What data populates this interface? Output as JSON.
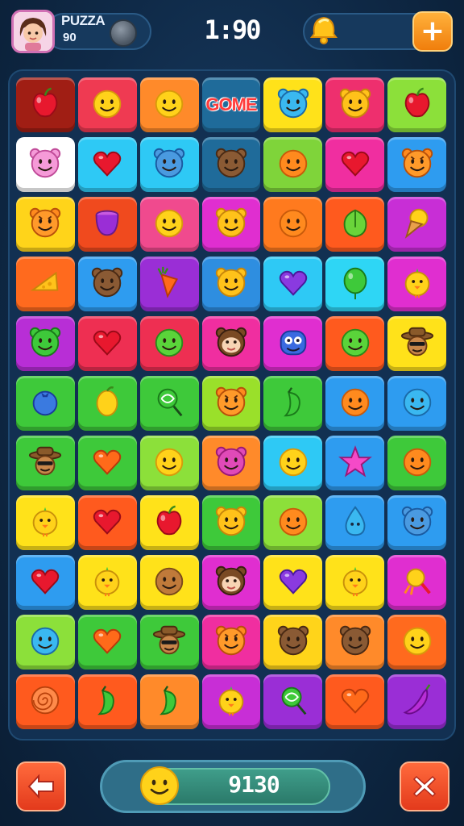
{
  "header": {
    "player_name": "PUZZA",
    "player_score": "90",
    "timer": "1:90",
    "add_button_label": "+"
  },
  "board": {
    "rows": 11,
    "cols": 7,
    "tiles": [
      [
        {
          "color": "#a01e14",
          "icon": "red-apple-icon"
        },
        {
          "color": "#ef3a52",
          "icon": "smiley-face-icon"
        },
        {
          "color": "#ff8a2a",
          "icon": "smiley-face-icon"
        },
        {
          "color": "#1f6b9a",
          "icon": "game-sign",
          "text": "GOME"
        },
        {
          "color": "#ffe21a",
          "icon": "blue-cat-face-icon"
        },
        {
          "color": "#ee2f6e",
          "icon": "yellow-bear-icon"
        },
        {
          "color": "#8ce03a",
          "icon": "red-apple-icon"
        }
      ],
      [
        {
          "color": "#ffffff",
          "icon": "pink-cat-face-icon"
        },
        {
          "color": "#2ec9f5",
          "icon": "red-heart-icon"
        },
        {
          "color": "#2ec9f5",
          "icon": "blue-bear-face-icon"
        },
        {
          "color": "#1f6b9a",
          "icon": "brown-bear-face-icon"
        },
        {
          "color": "#7fd43a",
          "icon": "orange-face-icon"
        },
        {
          "color": "#f02ea0",
          "icon": "red-heart-icon"
        },
        {
          "color": "#2e9cf0",
          "icon": "orange-tiger-face-icon"
        }
      ],
      [
        {
          "color": "#ffd41a",
          "icon": "orange-tiger-face-icon"
        },
        {
          "color": "#f04a1e",
          "icon": "purple-pot-icon"
        },
        {
          "color": "#f04a8e",
          "icon": "smiley-face-icon"
        },
        {
          "color": "#e02ed0",
          "icon": "yellow-bear-icon"
        },
        {
          "color": "#ff7a1e",
          "icon": "orange-face-icon"
        },
        {
          "color": "#ff5a1e",
          "icon": "green-fruit-icon"
        },
        {
          "color": "#c82ed6",
          "icon": "ice-cream-cone-icon"
        }
      ],
      [
        {
          "color": "#ff6a1e",
          "icon": "cheese-icon"
        },
        {
          "color": "#2e9cf0",
          "icon": "brown-bear-face-icon"
        },
        {
          "color": "#9a2ed6",
          "icon": "orange-carrot-icon"
        },
        {
          "color": "#2e8ee0",
          "icon": "yellow-bear-icon"
        },
        {
          "color": "#2ec9f5",
          "icon": "purple-heart-icon"
        },
        {
          "color": "#2ed6f5",
          "icon": "green-balloon-icon"
        },
        {
          "color": "#e02ed0",
          "icon": "yellow-chick-icon"
        }
      ],
      [
        {
          "color": "#b82ed6",
          "icon": "green-bear-face-icon"
        },
        {
          "color": "#ee2f52",
          "icon": "red-heart-icon"
        },
        {
          "color": "#ee2f52",
          "icon": "green-face-icon"
        },
        {
          "color": "#f02ea0",
          "icon": "monkey-face-icon"
        },
        {
          "color": "#e02ed0",
          "icon": "blue-monster-face-icon"
        },
        {
          "color": "#ff5a1e",
          "icon": "green-face-icon"
        },
        {
          "color": "#ffe21a",
          "icon": "cowboy-face-icon"
        }
      ],
      [
        {
          "color": "#3ec93a",
          "icon": "blue-blueberry-icon"
        },
        {
          "color": "#3ec93a",
          "icon": "yellow-lemon-icon"
        },
        {
          "color": "#3ec93a",
          "icon": "green-lollipop-icon"
        },
        {
          "color": "#9ae02a",
          "icon": "orange-tiger-face-icon"
        },
        {
          "color": "#3ec93a",
          "icon": "green-pepper-icon"
        },
        {
          "color": "#2e9cf0",
          "icon": "orange-face-icon"
        },
        {
          "color": "#2e9cf0",
          "icon": "blue-face-icon"
        }
      ],
      [
        {
          "color": "#3ec93a",
          "icon": "cowboy-face-icon"
        },
        {
          "color": "#3ec93a",
          "icon": "orange-heart-icon"
        },
        {
          "color": "#8ce03a",
          "icon": "smiley-face-icon"
        },
        {
          "color": "#ff8a2a",
          "icon": "pink-bear-face-icon"
        },
        {
          "color": "#2ec9f5",
          "icon": "smiley-face-icon"
        },
        {
          "color": "#2e9cf0",
          "icon": "pink-star-icon"
        },
        {
          "color": "#3ec93a",
          "icon": "orange-face-icon"
        }
      ],
      [
        {
          "color": "#ffe21a",
          "icon": "yellow-chick-icon"
        },
        {
          "color": "#ff5a1e",
          "icon": "red-heart-icon"
        },
        {
          "color": "#ffe21a",
          "icon": "red-apple-icon"
        },
        {
          "color": "#3ec93a",
          "icon": "yellow-bear-icon"
        },
        {
          "color": "#8ce03a",
          "icon": "orange-face-icon"
        },
        {
          "color": "#2e9cf0",
          "icon": "blue-drop-face-icon"
        },
        {
          "color": "#2e9cf0",
          "icon": "blue-bear-face-icon"
        }
      ],
      [
        {
          "color": "#2e9cf0",
          "icon": "red-heart-icon"
        },
        {
          "color": "#ffe21a",
          "icon": "yellow-chick-icon"
        },
        {
          "color": "#ffe21a",
          "icon": "brown-face-icon"
        },
        {
          "color": "#e02ed0",
          "icon": "monkey-face-icon"
        },
        {
          "color": "#ffe21a",
          "icon": "purple-heart-icon"
        },
        {
          "color": "#ffe21a",
          "icon": "yellow-chick-icon"
        },
        {
          "color": "#e02ed0",
          "icon": "yellow-candy-icon"
        }
      ],
      [
        {
          "color": "#8ce03a",
          "icon": "blue-face-icon"
        },
        {
          "color": "#3ec93a",
          "icon": "orange-heart-icon"
        },
        {
          "color": "#3ec93a",
          "icon": "cowboy-face-icon"
        },
        {
          "color": "#f02ea0",
          "icon": "orange-tiger-face-icon"
        },
        {
          "color": "#ffd41a",
          "icon": "brown-bear-face-icon"
        },
        {
          "color": "#ff8a2a",
          "icon": "brown-bear-face-icon"
        },
        {
          "color": "#ff6a1e",
          "icon": "smiley-face-icon"
        }
      ],
      [
        {
          "color": "#ff5a1e",
          "icon": "orange-swirl-candy-icon"
        },
        {
          "color": "#ff5a1e",
          "icon": "green-pepper-icon"
        },
        {
          "color": "#ff8a2a",
          "icon": "green-pepper-icon"
        },
        {
          "color": "#c82ed6",
          "icon": "yellow-chick-icon"
        },
        {
          "color": "#9a2ed6",
          "icon": "green-lollipop-icon"
        },
        {
          "color": "#ff5a1e",
          "icon": "orange-heart-icon"
        },
        {
          "color": "#9a2ed6",
          "icon": "purple-pepper-icon"
        }
      ]
    ]
  },
  "footer": {
    "score": "9130",
    "back_icon": "back-arrow-icon",
    "close_icon": "close-x-icon"
  },
  "colors": {
    "background": "#0f2a48",
    "accent_orange": "#f07e0c",
    "button_red": "#e33a1c"
  }
}
